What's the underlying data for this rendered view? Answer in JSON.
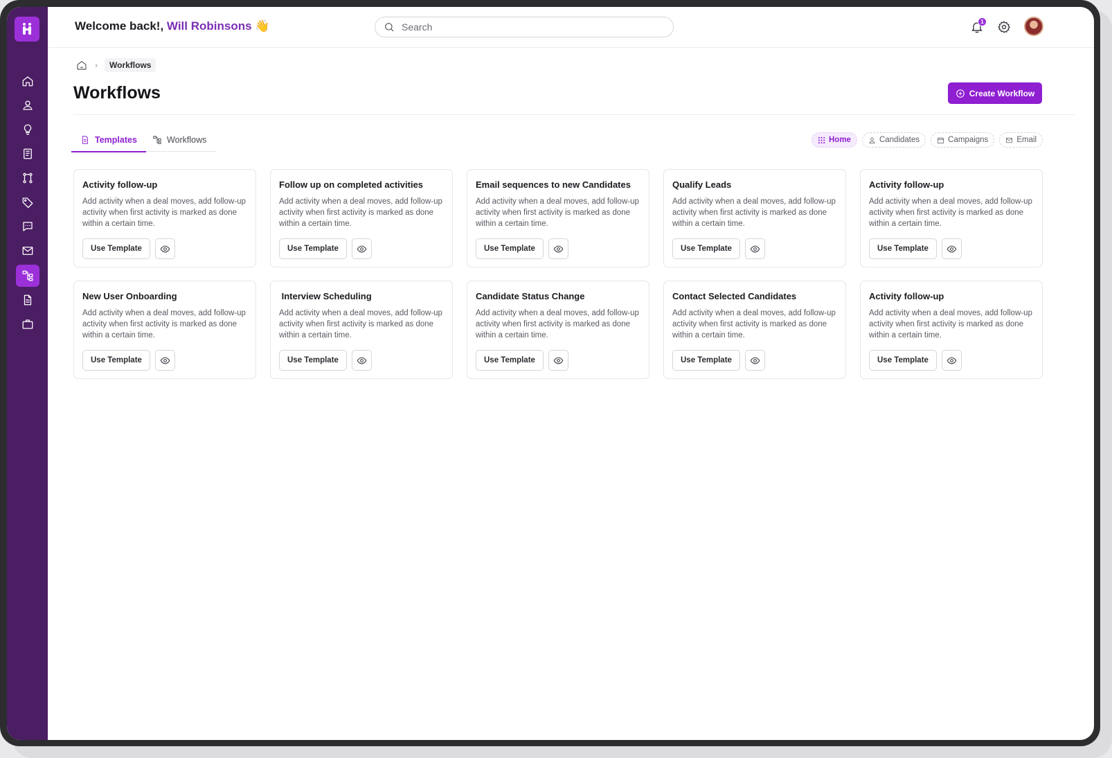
{
  "header": {
    "greeting": "Welcome back!,",
    "user_name": "Will Robinsons",
    "wave": "👋",
    "search_placeholder": "Search",
    "notification_count": "1"
  },
  "sidebar": {
    "items": [
      {
        "icon": "home-icon",
        "active": false
      },
      {
        "icon": "user-icon",
        "active": false
      },
      {
        "icon": "lightbulb-icon",
        "active": false
      },
      {
        "icon": "book-icon",
        "active": false
      },
      {
        "icon": "pipeline-icon",
        "active": false
      },
      {
        "icon": "tag-icon",
        "active": false
      },
      {
        "icon": "message-icon",
        "active": false
      },
      {
        "icon": "mail-icon",
        "active": false
      },
      {
        "icon": "workflow-icon",
        "active": true
      },
      {
        "icon": "document-icon",
        "active": false
      },
      {
        "icon": "briefcase-icon",
        "active": false
      }
    ]
  },
  "breadcrumb": {
    "current": "Workflows"
  },
  "page": {
    "title": "Workflows",
    "create_label": "Create Workflow"
  },
  "tabs": [
    {
      "label": "Templates",
      "active": true
    },
    {
      "label": "Workflows",
      "active": false
    }
  ],
  "filters": [
    {
      "label": "Home",
      "icon": "grid-icon",
      "active": true
    },
    {
      "label": "Candidates",
      "icon": "user-icon",
      "active": false
    },
    {
      "label": "Campaigns",
      "icon": "calendar-icon",
      "active": false
    },
    {
      "label": "Email",
      "icon": "mail-icon",
      "active": false
    }
  ],
  "cards": [
    {
      "title": "Activity follow-up",
      "description": "Add activity when a deal moves, add follow-up activity when first activity is marked as done within a certain time.",
      "button": "Use Template"
    },
    {
      "title": "Follow up on completed activities",
      "description": "Add activity when a deal moves, add follow-up activity when first activity is marked as done within a certain time.",
      "button": "Use Template"
    },
    {
      "title": "Email sequences to new Candidates",
      "description": "Add activity when a deal moves, add follow-up activity when first activity is marked as done within a certain time.",
      "button": "Use Template"
    },
    {
      "title": "Qualify Leads",
      "description": "Add activity when a deal moves, add follow-up activity when first activity is marked as done within a certain time.",
      "button": "Use Template"
    },
    {
      "title": "Activity follow-up",
      "description": "Add activity when a deal moves, add follow-up activity when first activity is marked as done within a certain time.",
      "button": "Use Template"
    },
    {
      "title": "New User Onboarding",
      "description": "Add activity when a deal moves, add follow-up activity when first activity is marked as done within a certain time.",
      "button": "Use Template"
    },
    {
      "title": " Interview Scheduling",
      "description": "Add activity when a deal moves, add follow-up activity when first activity is marked as done within a certain time.",
      "button": "Use Template"
    },
    {
      "title": "Candidate Status Change",
      "description": "Add activity when a deal moves, add follow-up activity when first activity is marked as done within a certain time.",
      "button": "Use Template"
    },
    {
      "title": "Contact Selected Candidates",
      "description": "Add activity when a deal moves, add follow-up activity when first activity is marked as done within a certain time.",
      "button": "Use Template"
    },
    {
      "title": "Activity follow-up",
      "description": "Add activity when a deal moves, add follow-up activity when first activity is marked as done within a certain time.",
      "button": "Use Template"
    }
  ],
  "colors": {
    "accent": "#8f1fd1",
    "sidebar": "#4b1d63",
    "name": "#7c2fb5"
  }
}
